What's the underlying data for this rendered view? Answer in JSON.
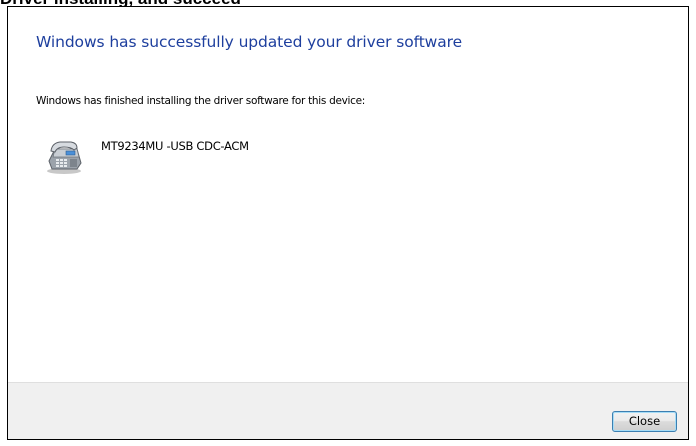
{
  "top_caption": "Driver installing, and succeed",
  "dialog": {
    "headline": "Windows has successfully updated your driver software",
    "info_text": "Windows has finished installing the driver software for this device:",
    "device": {
      "icon": "modem-phone-icon",
      "name": "MT9234MU -USB CDC-ACM"
    },
    "close_label": "Close"
  },
  "colors": {
    "headline": "#1e3f9e",
    "footer_background": "#f0f0f0",
    "button_border": "#3c7fb1"
  }
}
